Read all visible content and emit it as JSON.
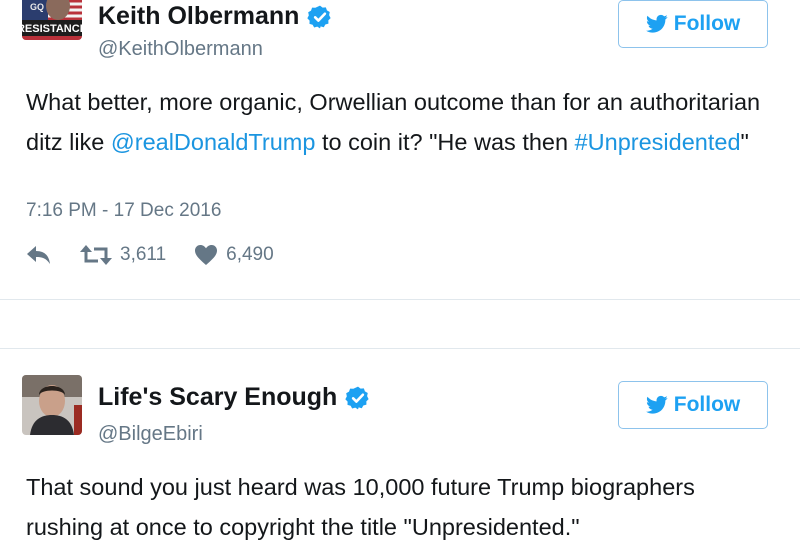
{
  "tweets": [
    {
      "name": "Keith Olbermann",
      "handle": "@KeithOlbermann",
      "follow_label": "Follow",
      "avatar_text": "RESISTANCE",
      "avatar_top_text": "GQ",
      "text_parts": [
        "What better, more organic, Orwellian outcome than for an authoritarian ditz like ",
        "@realDonaldTrump",
        " to coin it? \"He was then ",
        "#Unpresidented",
        "\""
      ],
      "timestamp": "7:16 PM - 17 Dec 2016",
      "retweets": "3,611",
      "likes": "6,490"
    },
    {
      "name": "Life's Scary Enough",
      "handle": "@BilgeEbiri",
      "follow_label": "Follow",
      "text": "That sound you just heard was 10,000 future Trump biographers rushing at once to copyright the title \"Unpresidented.\""
    }
  ],
  "colors": {
    "link": "#1b95e0",
    "verified": "#1da1f2",
    "muted": "#657786",
    "border": "#e1e8ed"
  }
}
